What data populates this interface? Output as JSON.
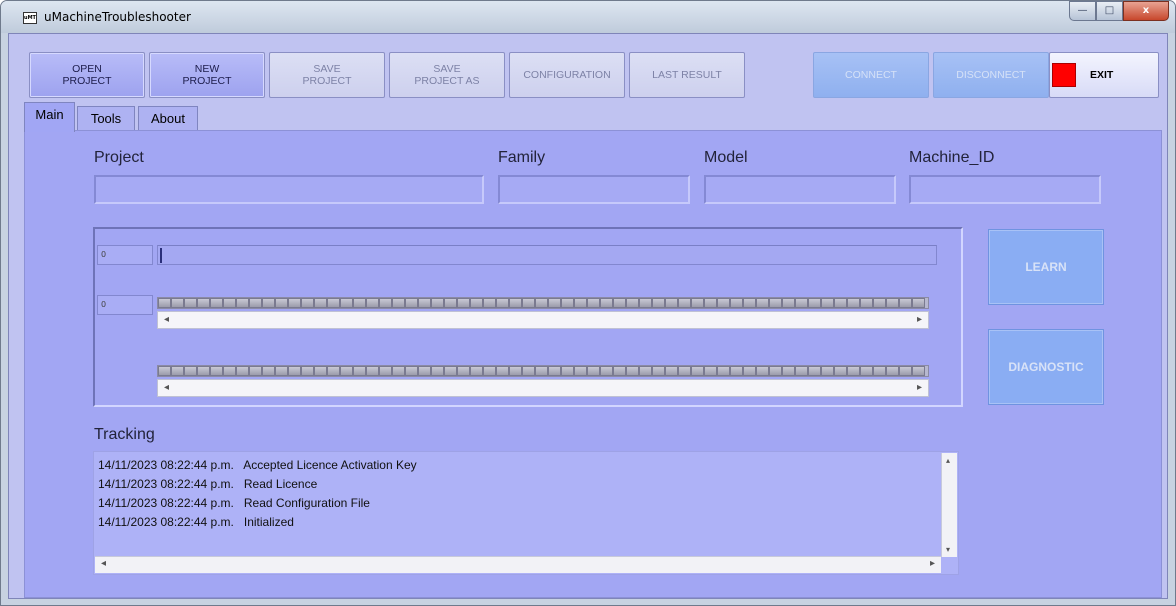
{
  "window": {
    "title": "uMachineTroubleshooter",
    "icon_text": "uMT",
    "controls": {
      "minimize": "—",
      "maximize": "□",
      "close": "x"
    }
  },
  "toolbar": {
    "open_project": "OPEN\nPROJECT",
    "new_project": "NEW\nPROJECT",
    "save_project": "SAVE\nPROJECT",
    "save_project_as": "SAVE\nPROJECT AS",
    "configuration": "CONFIGURATION",
    "last_result": "LAST RESULT",
    "connect": "CONNECT",
    "disconnect": "DISCONNECT",
    "exit": "EXIT"
  },
  "tabs": [
    {
      "label": "Main"
    },
    {
      "label": "Tools"
    },
    {
      "label": "About"
    }
  ],
  "fields": {
    "project": {
      "label": "Project",
      "value": ""
    },
    "family": {
      "label": "Family",
      "value": ""
    },
    "model": {
      "label": "Model",
      "value": ""
    },
    "machine_id": {
      "label": "Machine_ID",
      "value": ""
    }
  },
  "signals": {
    "row1_value": "0",
    "row2_value": "0",
    "progress_fraction": 0.0
  },
  "actions": {
    "learn": "LEARN",
    "diagnostic": "DIAGNOSTIC"
  },
  "tracking": {
    "label": "Tracking",
    "lines": [
      "14/11/2023 08:22:44 p.m.   Accepted Licence Activation Key",
      "14/11/2023 08:22:44 p.m.   Read Licence",
      "14/11/2023 08:22:44 p.m.   Read Configuration File",
      "14/11/2023 08:22:44 p.m.   Initialized"
    ]
  },
  "colors": {
    "panel": "#a2a6f3",
    "accent_blue": "#8aadf3",
    "exit_indicator": "#ff0000"
  },
  "icons": {
    "scroll_left": "◂",
    "scroll_right": "▸",
    "scroll_up": "▴",
    "scroll_down": "▾"
  }
}
